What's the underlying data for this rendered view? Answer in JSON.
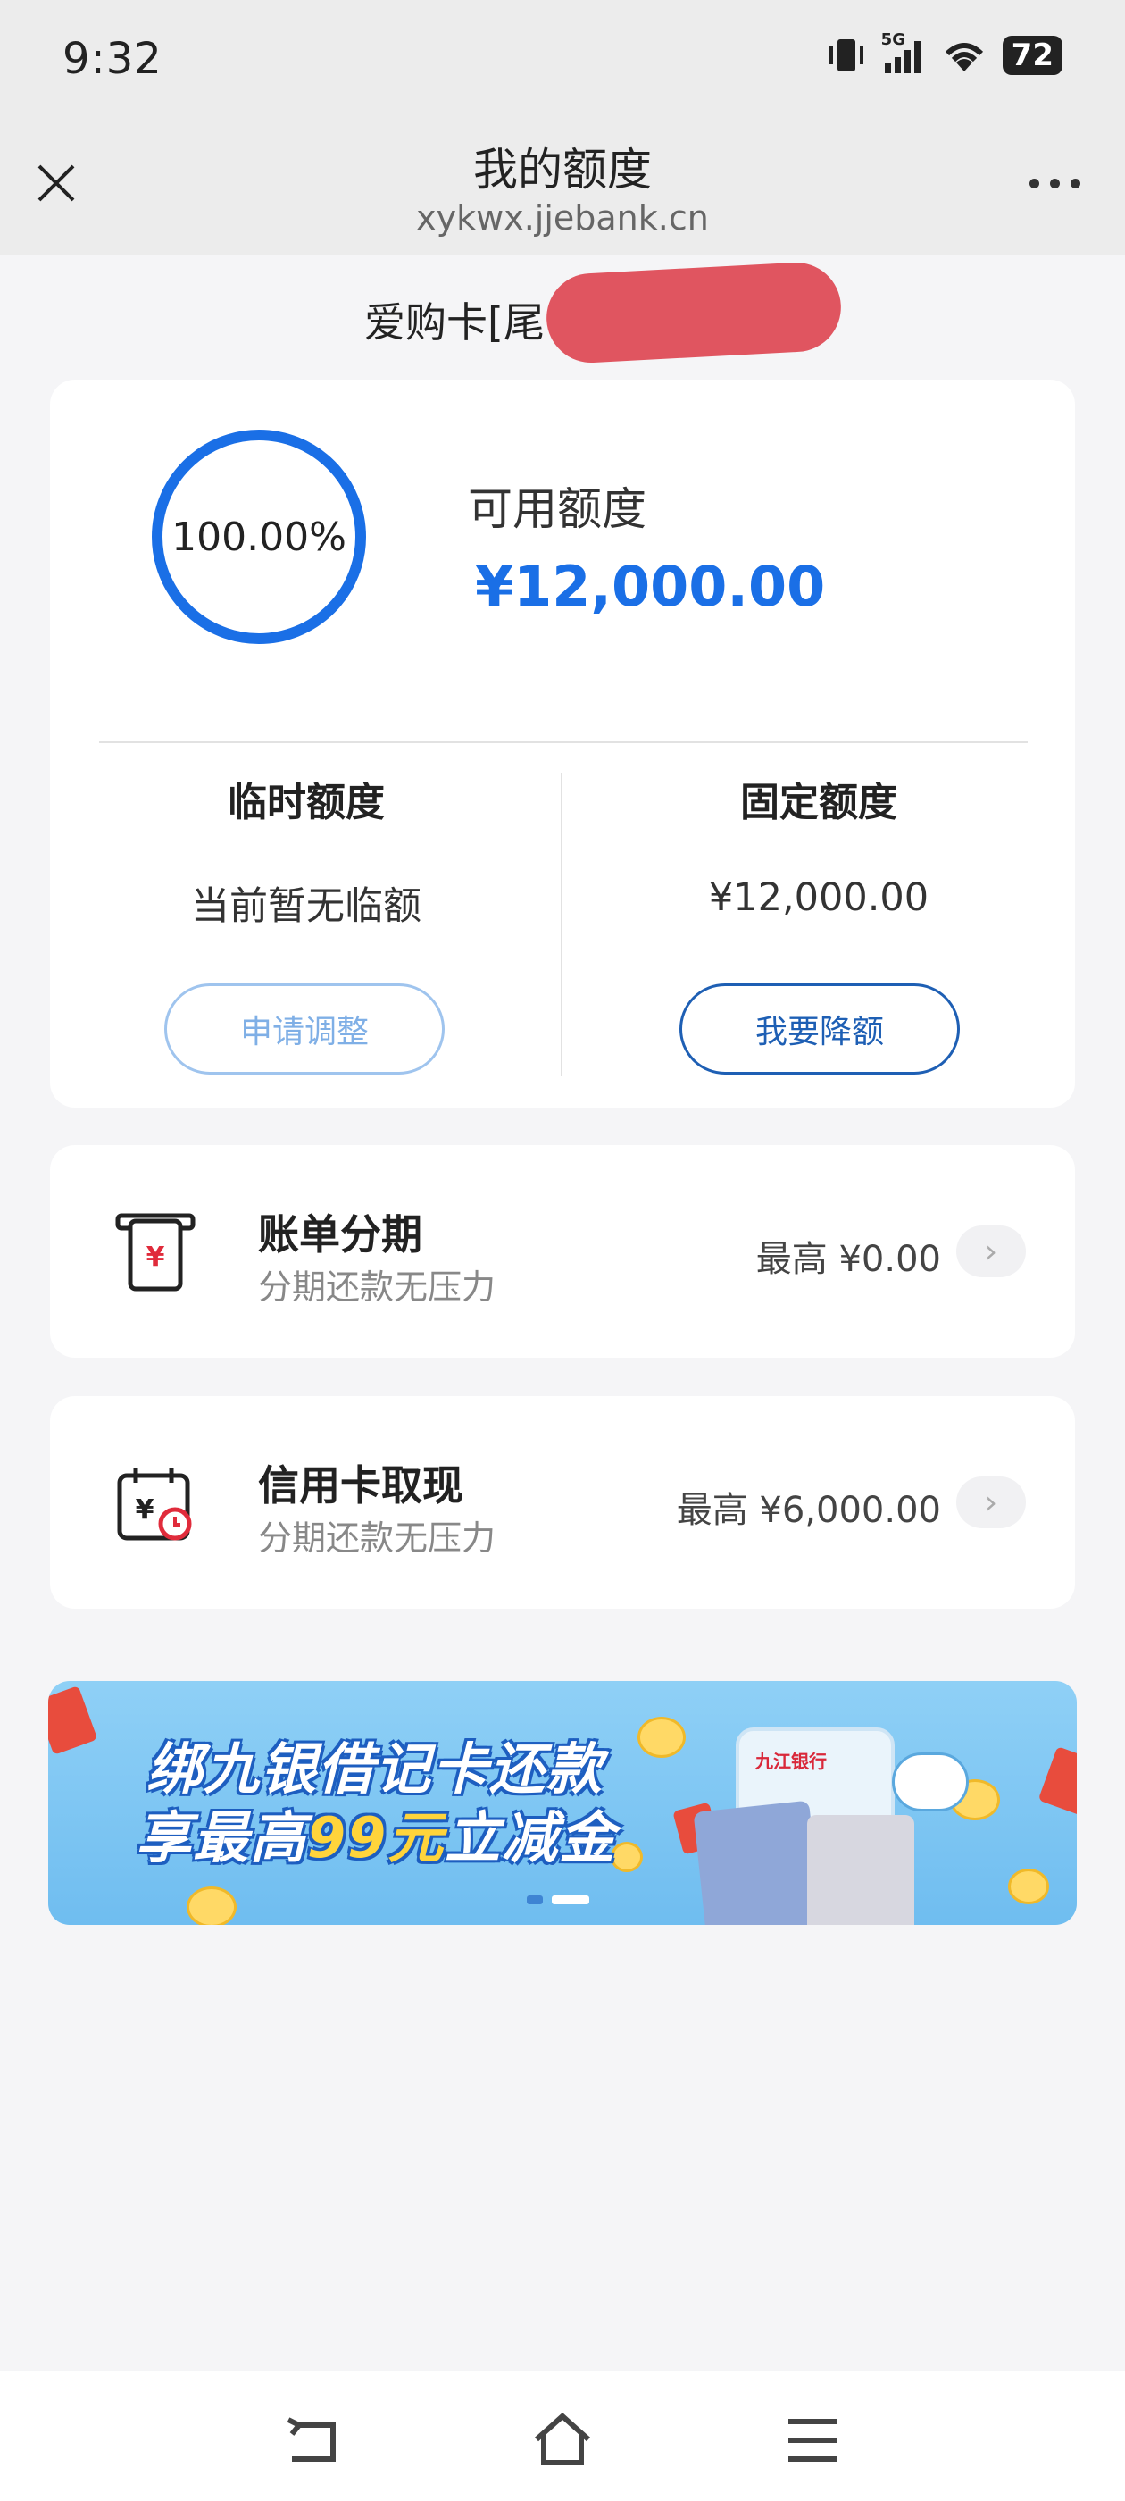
{
  "status": {
    "time": "9:32",
    "signal": "5G",
    "battery": "72"
  },
  "nav": {
    "title": "我的额度",
    "url": "xykwx.jjebank.cn"
  },
  "card_name": "爱购卡[尾号",
  "quota": {
    "percent_text": "100.00%",
    "percent": 100,
    "available_label": "可用额度",
    "available_amount": "¥12,000.00",
    "accent_color": "#1a6fe6",
    "temp": {
      "title": "临时额度",
      "value": "当前暂无临额",
      "button": "申请调整"
    },
    "fixed": {
      "title": "固定额度",
      "value": "¥12,000.00",
      "button": "我要降额"
    }
  },
  "rows": [
    {
      "title": "账单分期",
      "subtitle": "分期还款无压力",
      "value": "最高 ¥0.00",
      "icon": "bill-icon"
    },
    {
      "title": "信用卡取现",
      "subtitle": "分期还款无压力",
      "value": "最高 ¥6,000.00",
      "icon": "calendar-cash-icon"
    }
  ],
  "banner": {
    "line1": "绑九银借记卡还款",
    "line2_pre": "享最高",
    "line2_hl": "99元",
    "line2_post": "立减金",
    "phone_logo": "九江银行"
  }
}
